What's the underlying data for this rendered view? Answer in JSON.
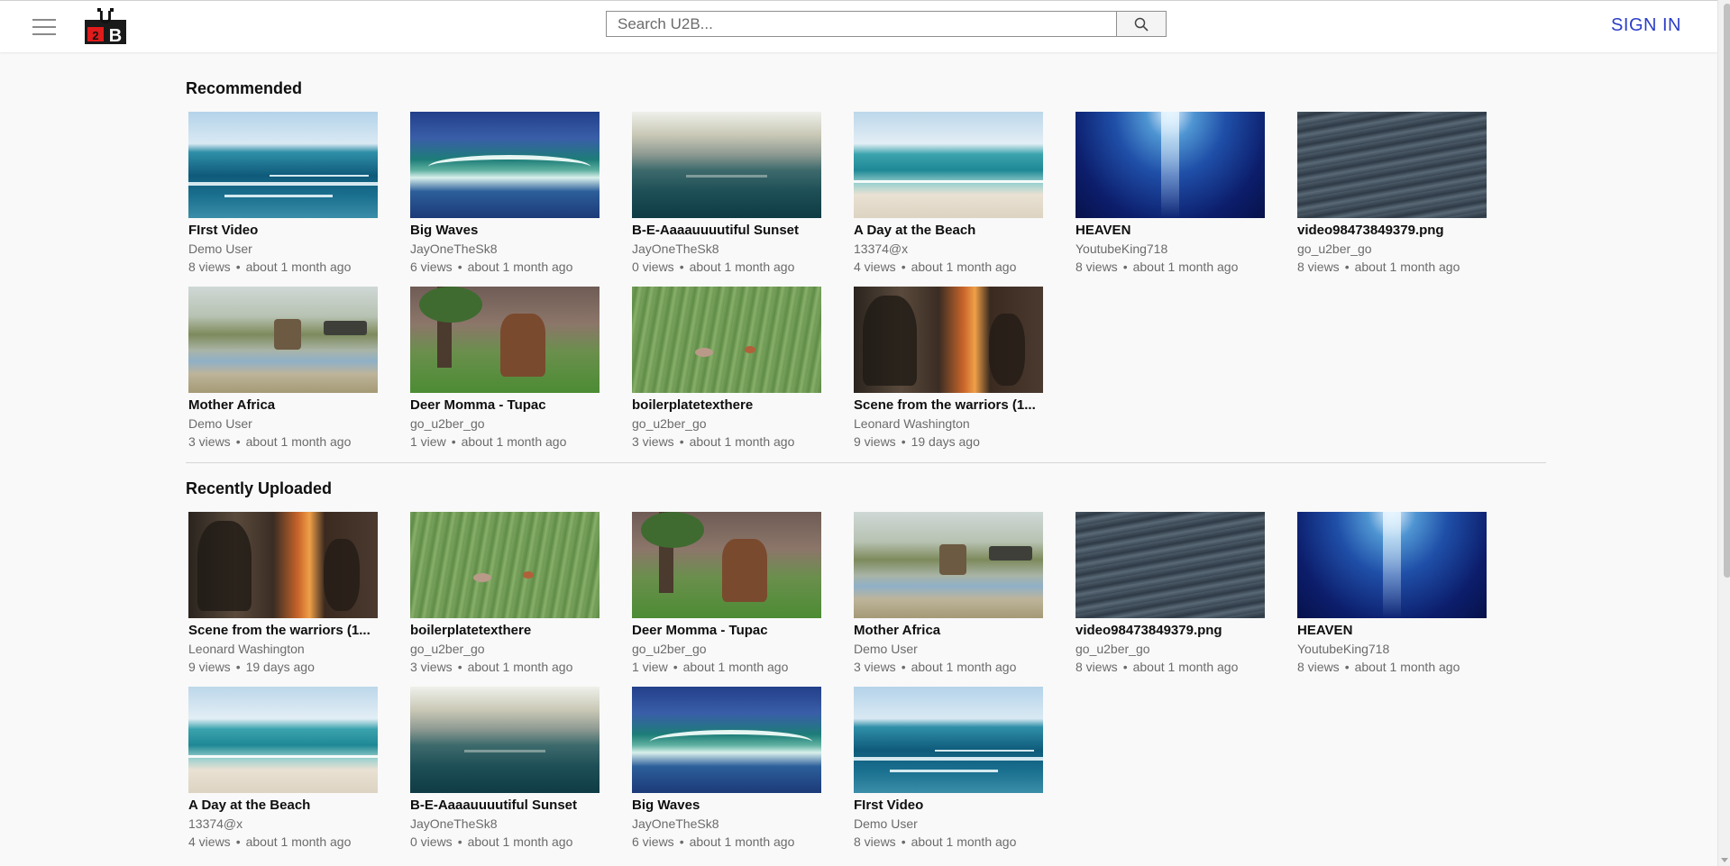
{
  "header": {
    "search_placeholder": "Search U2B...",
    "signin_label": "SIGN IN",
    "logo_text": "Ü2B"
  },
  "sections": [
    {
      "title": "Recommended",
      "videos": [
        {
          "title": "FIrst Video",
          "channel": "Demo User",
          "views": "8 views",
          "age": "about 1 month ago",
          "thumb": "ocean1"
        },
        {
          "title": "Big Waves",
          "channel": "JayOneTheSk8",
          "views": "6 views",
          "age": "about 1 month ago",
          "thumb": "wave"
        },
        {
          "title": "B-E-Aaaauuuutiful Sunset",
          "channel": "JayOneTheSk8",
          "views": "0 views",
          "age": "about 1 month ago",
          "thumb": "sunset"
        },
        {
          "title": "A Day at the Beach",
          "channel": "13374@x",
          "views": "4 views",
          "age": "about 1 month ago",
          "thumb": "beach"
        },
        {
          "title": "HEAVEN",
          "channel": "YoutubeKing718",
          "views": "8 views",
          "age": "about 1 month ago",
          "thumb": "heaven"
        },
        {
          "title": "video98473849379.png",
          "channel": "go_u2ber_go",
          "views": "8 views",
          "age": "about 1 month ago",
          "thumb": "water"
        },
        {
          "title": "Mother Africa",
          "channel": "Demo User",
          "views": "3 views",
          "age": "about 1 month ago",
          "thumb": "africa"
        },
        {
          "title": "Deer Momma - Tupac",
          "channel": "go_u2ber_go",
          "views": "1 view",
          "age": "about 1 month ago",
          "thumb": "deer"
        },
        {
          "title": "boilerplatetexthere",
          "channel": "go_u2ber_go",
          "views": "3 views",
          "age": "about 1 month ago",
          "thumb": "boiler"
        },
        {
          "title": "Scene from the warriors (1...",
          "channel": "Leonard Washington",
          "views": "9 views",
          "age": "19 days ago",
          "thumb": "warriors"
        }
      ]
    },
    {
      "title": "Recently Uploaded",
      "videos": [
        {
          "title": "Scene from the warriors (1...",
          "channel": "Leonard Washington",
          "views": "9 views",
          "age": "19 days ago",
          "thumb": "warriors"
        },
        {
          "title": "boilerplatetexthere",
          "channel": "go_u2ber_go",
          "views": "3 views",
          "age": "about 1 month ago",
          "thumb": "boiler"
        },
        {
          "title": "Deer Momma - Tupac",
          "channel": "go_u2ber_go",
          "views": "1 view",
          "age": "about 1 month ago",
          "thumb": "deer"
        },
        {
          "title": "Mother Africa",
          "channel": "Demo User",
          "views": "3 views",
          "age": "about 1 month ago",
          "thumb": "africa"
        },
        {
          "title": "video98473849379.png",
          "channel": "go_u2ber_go",
          "views": "8 views",
          "age": "about 1 month ago",
          "thumb": "water"
        },
        {
          "title": "HEAVEN",
          "channel": "YoutubeKing718",
          "views": "8 views",
          "age": "about 1 month ago",
          "thumb": "heaven"
        },
        {
          "title": "A Day at the Beach",
          "channel": "13374@x",
          "views": "4 views",
          "age": "about 1 month ago",
          "thumb": "beach"
        },
        {
          "title": "B-E-Aaaauuuutiful Sunset",
          "channel": "JayOneTheSk8",
          "views": "0 views",
          "age": "about 1 month ago",
          "thumb": "sunset"
        },
        {
          "title": "Big Waves",
          "channel": "JayOneTheSk8",
          "views": "6 views",
          "age": "about 1 month ago",
          "thumb": "wave"
        },
        {
          "title": "FIrst Video",
          "channel": "Demo User",
          "views": "8 views",
          "age": "about 1 month ago",
          "thumb": "ocean1"
        }
      ]
    }
  ],
  "colors": {
    "accent": "#2c3ec8",
    "logo_red": "#e01b1b",
    "background": "#f9f9f9"
  },
  "icons": {
    "menu": "hamburger-icon",
    "search": "search-icon"
  }
}
